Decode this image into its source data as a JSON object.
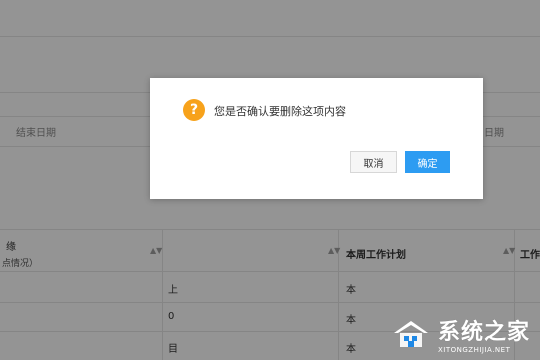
{
  "background": {
    "filter_label_left": "结束日期",
    "filter_label_right": "日期",
    "table": {
      "col1_header": "缘",
      "col1_subheader": "点情况）",
      "col2_header": "",
      "col3_header": "本周工作计划",
      "col4_header": "工作",
      "rows": [
        {
          "c1": "上",
          "c3": "本"
        },
        {
          "c1": "0",
          "c3": "本"
        },
        {
          "c1": "目",
          "c3": "本"
        }
      ]
    }
  },
  "dialog": {
    "icon": "question-icon",
    "message": "您是否确认要删除这项内容",
    "cancel_label": "取消",
    "confirm_label": "确定",
    "accent_color": "#2d9cf2",
    "warning_color": "#f7a21b"
  },
  "watermark": {
    "title": "系统之家",
    "url": "XITONGZHIJIA.NET"
  }
}
